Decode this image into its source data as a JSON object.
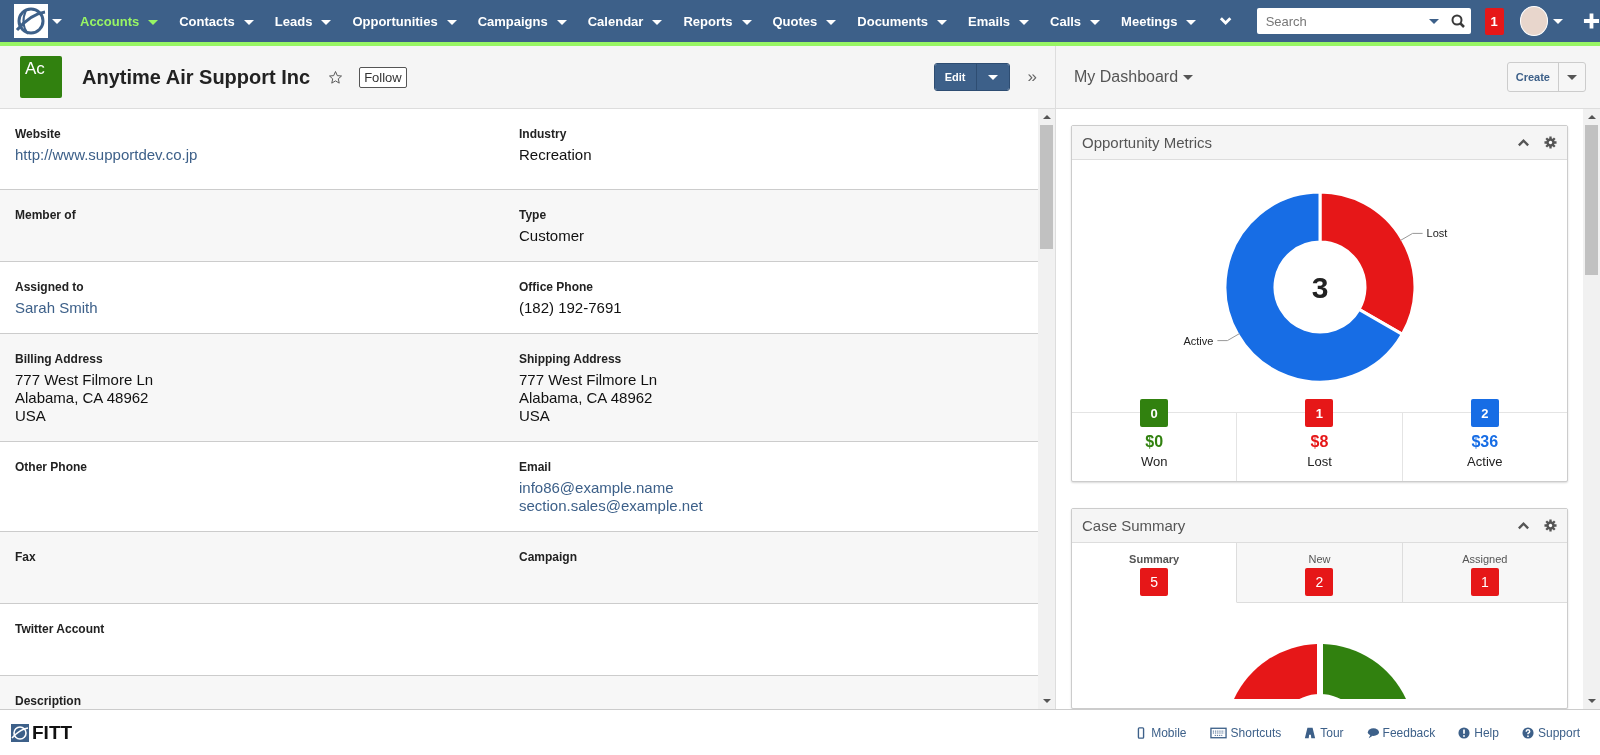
{
  "nav": {
    "items": [
      {
        "label": "Accounts",
        "selected": true
      },
      {
        "label": "Contacts",
        "selected": false
      },
      {
        "label": "Leads",
        "selected": false
      },
      {
        "label": "Opportunities",
        "selected": false
      },
      {
        "label": "Campaigns",
        "selected": false
      },
      {
        "label": "Calendar",
        "selected": false
      },
      {
        "label": "Reports",
        "selected": false
      },
      {
        "label": "Quotes",
        "selected": false
      },
      {
        "label": "Documents",
        "selected": false
      },
      {
        "label": "Emails",
        "selected": false
      },
      {
        "label": "Calls",
        "selected": false
      },
      {
        "label": "Meetings",
        "selected": false
      }
    ],
    "search": {
      "placeholder": "Search"
    },
    "notifications": "1"
  },
  "record": {
    "avatar": "Ac",
    "name": "Anytime Air Support Inc",
    "follow": "Follow",
    "edit": "Edit",
    "rows": [
      [
        {
          "label": "Website",
          "values": [
            {
              "text": "http://www.supportdev.co.jp",
              "kind": "link"
            }
          ]
        },
        {
          "label": "Industry",
          "values": [
            {
              "text": "Recreation",
              "kind": "text"
            }
          ]
        }
      ],
      [
        {
          "label": "Member of"
        },
        {
          "label": "Type",
          "values": [
            {
              "text": "Customer",
              "kind": "text"
            }
          ]
        }
      ],
      [
        {
          "label": "Assigned to",
          "values": [
            {
              "text": "Sarah Smith",
              "kind": "link"
            }
          ]
        },
        {
          "label": "Office Phone",
          "values": [
            {
              "text": "(182) 192-7691",
              "kind": "text"
            }
          ]
        }
      ],
      [
        {
          "label": "Billing Address",
          "values": [
            {
              "text": "777 West Filmore Ln",
              "kind": "text"
            },
            {
              "text": "Alabama, CA 48962",
              "kind": "text"
            },
            {
              "text": "USA",
              "kind": "text"
            }
          ]
        },
        {
          "label": "Shipping Address",
          "values": [
            {
              "text": "777 West Filmore Ln",
              "kind": "text"
            },
            {
              "text": "Alabama, CA 48962",
              "kind": "text"
            },
            {
              "text": "USA",
              "kind": "text"
            }
          ]
        }
      ],
      [
        {
          "label": "Other Phone"
        },
        {
          "label": "Email",
          "values": [
            {
              "text": "info86@example.name",
              "kind": "link"
            },
            {
              "text": "section.sales@example.net",
              "kind": "link"
            }
          ]
        }
      ],
      [
        {
          "label": "Fax"
        },
        {
          "label": "Campaign"
        }
      ],
      [
        {
          "label": "Twitter Account"
        }
      ],
      [
        {
          "label": "Description"
        }
      ]
    ],
    "expand": "»"
  },
  "dashboard": {
    "title": "My Dashboard",
    "create": "Create",
    "opportunity_metrics": {
      "title": "Opportunity Metrics",
      "total": "3",
      "chart_data": {
        "type": "donut",
        "categories": [
          "Lost",
          "Active"
        ],
        "values": [
          33.3,
          66.7
        ]
      },
      "stats": [
        {
          "count": "0",
          "amount": "$0",
          "label": "Won",
          "color": "#31810f"
        },
        {
          "count": "1",
          "amount": "$8",
          "label": "Lost",
          "color": "#e61718"
        },
        {
          "count": "2",
          "amount": "$36",
          "label": "Active",
          "color": "#176de5"
        }
      ]
    },
    "case_summary": {
      "title": "Case Summary",
      "tabs": [
        {
          "label": "Summary",
          "count": "5",
          "selected": true
        },
        {
          "label": "New",
          "count": "2",
          "selected": false
        },
        {
          "label": "Assigned",
          "count": "1",
          "selected": false
        }
      ]
    }
  },
  "footer": {
    "logo": "FITT",
    "links": [
      {
        "label": "Mobile",
        "kind": "mobile"
      },
      {
        "label": "Shortcuts",
        "kind": "keyboard"
      },
      {
        "label": "Tour",
        "kind": "road"
      },
      {
        "label": "Feedback",
        "kind": "bubble"
      },
      {
        "label": "Help",
        "kind": "help"
      },
      {
        "label": "Support",
        "kind": "question"
      }
    ]
  }
}
